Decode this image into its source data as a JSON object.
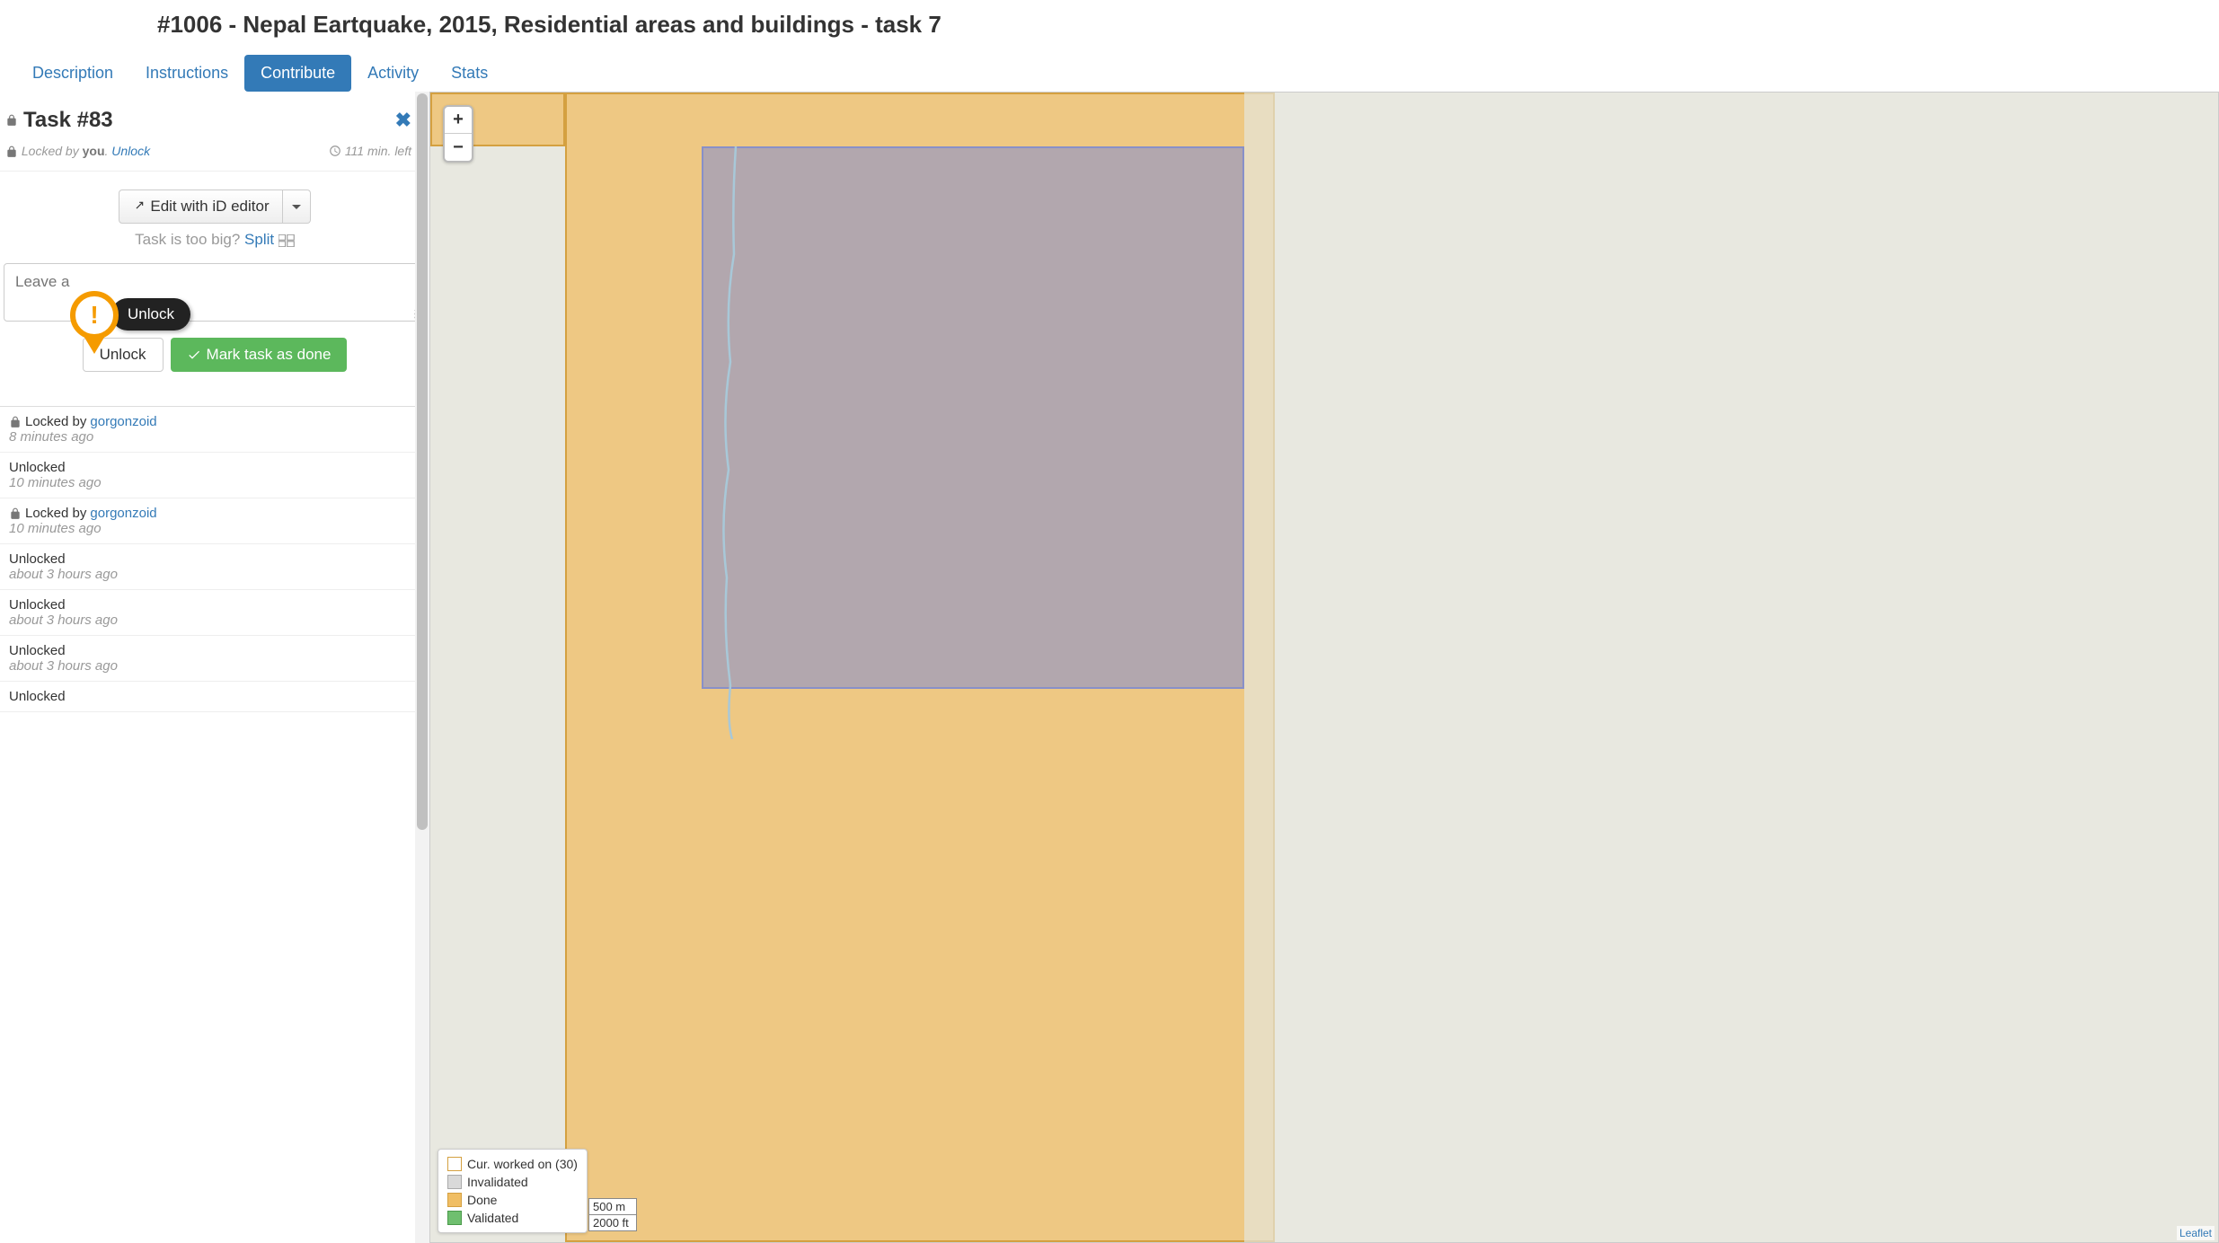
{
  "header": {
    "title": "#1006 - Nepal Eartquake, 2015, Residential areas and buildings - task 7"
  },
  "tabs": {
    "items": [
      {
        "label": "Description",
        "active": false
      },
      {
        "label": "Instructions",
        "active": false
      },
      {
        "label": "Contribute",
        "active": true
      },
      {
        "label": "Activity",
        "active": false
      },
      {
        "label": "Stats",
        "active": false
      }
    ]
  },
  "task": {
    "title": "Task #83",
    "locked_prefix": "Locked by ",
    "locked_by": "you",
    "locked_suffix": ".  ",
    "unlock_link": "Unlock",
    "time_left": "111 min. left",
    "edit_button": "Edit with iD editor",
    "split_prompt": "Task is too big? ",
    "split_link": "Split",
    "comment_placeholder": "Leave a",
    "tooltip_label": "Unlock",
    "unlock_button": "Unlock",
    "done_button": "Mark task as done"
  },
  "history": [
    {
      "locked": true,
      "prefix": "Locked by ",
      "user": "gorgonzoid",
      "ago": "8 minutes ago"
    },
    {
      "locked": false,
      "text": "Unlocked",
      "ago": "10 minutes ago"
    },
    {
      "locked": true,
      "prefix": "Locked by ",
      "user": "gorgonzoid",
      "ago": "10 minutes ago"
    },
    {
      "locked": false,
      "text": "Unlocked",
      "ago": "about 3 hours ago"
    },
    {
      "locked": false,
      "text": "Unlocked",
      "ago": "about 3 hours ago"
    },
    {
      "locked": false,
      "text": "Unlocked",
      "ago": "about 3 hours ago"
    },
    {
      "locked": false,
      "text": "Unlocked",
      "ago": ""
    }
  ],
  "map": {
    "zoom_in": "+",
    "zoom_out": "−",
    "legend": [
      {
        "label": "Cur. worked on (30)",
        "color": "rgba(255,255,255,0.5)",
        "border": "#d4a040"
      },
      {
        "label": "Invalidated",
        "color": "#d9d9d9",
        "border": "#aaa"
      },
      {
        "label": "Done",
        "color": "#f0be64",
        "border": "#d4a040"
      },
      {
        "label": "Validated",
        "color": "#6fbf6f",
        "border": "#4a9a4a"
      }
    ],
    "scale_m": "500 m",
    "scale_ft": "2000 ft",
    "attribution": "Leaflet"
  }
}
